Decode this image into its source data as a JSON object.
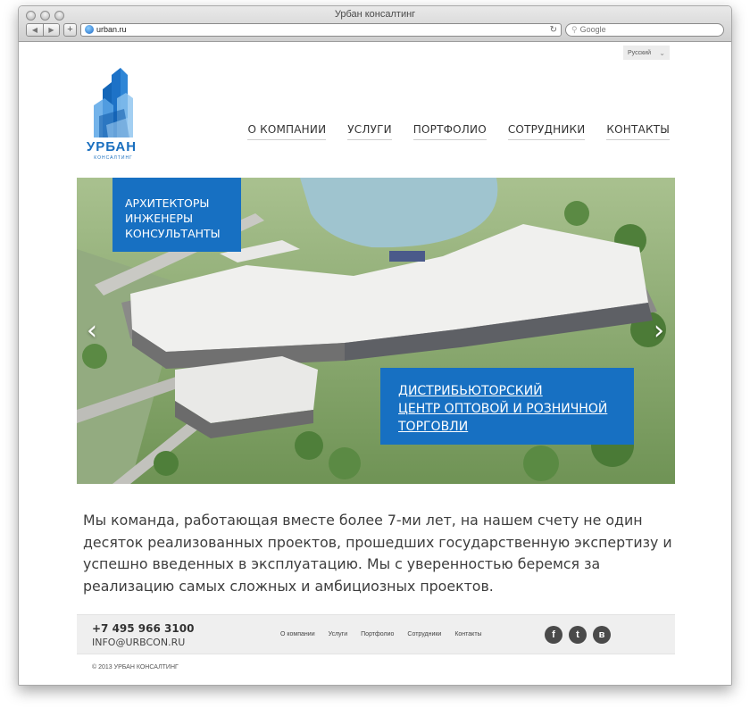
{
  "browser": {
    "window_title": "Урбан консалтинг",
    "url": "urban.ru",
    "search_placeholder": "Google",
    "back_icon": "back-arrow-icon",
    "forward_icon": "forward-arrow-icon",
    "add_icon": "plus-icon",
    "reload_icon": "reload-icon",
    "search_icon": "search-icon"
  },
  "language": {
    "selected": "Русский"
  },
  "logo": {
    "word": "УРБАН",
    "sub": "КОНСАЛТИНГ",
    "color": "#1a6fbf"
  },
  "nav": [
    {
      "label": "О КОМПАНИИ"
    },
    {
      "label": "УСЛУГИ"
    },
    {
      "label": "ПОРТФОЛИО"
    },
    {
      "label": "СОТРУДНИКИ"
    },
    {
      "label": "КОНТАКТЫ"
    }
  ],
  "hero": {
    "tagline": [
      "АРХИТЕКТОРЫ",
      "ИНЖЕНЕРЫ",
      "КОНСУЛЬТАНТЫ"
    ],
    "project_lines": [
      "ДИСТРИБЬЮТОРСКИЙ ",
      "ЦЕНТР ОПТОВОЙ И РОЗНИЧНОЙ ",
      "ТОРГОВЛИ"
    ],
    "prev": "‹",
    "next": "›",
    "accent": "#1770c2"
  },
  "intro": "Мы команда, работающая вместе более 7-ми лет, на нашем счету не один десяток реализованных проектов, прошедших государственную экспертизу и успешно введенных в эксплуатацию. Мы с уверенностью беремся за реализацию самых сложных и амбициозных проектов.",
  "footer": {
    "phone": "+7 495 966 3100",
    "email": "INFO@URBCON.RU",
    "nav": [
      {
        "label": "О компании"
      },
      {
        "label": "Услуги"
      },
      {
        "label": "Портфолио"
      },
      {
        "label": "Сотрудники"
      },
      {
        "label": "Контакты"
      }
    ],
    "social": [
      {
        "glyph": "f",
        "icon": "facebook-icon"
      },
      {
        "glyph": "t",
        "icon": "twitter-icon"
      },
      {
        "glyph": "в",
        "icon": "vkontakte-icon"
      }
    ],
    "copyright": "© 2013 УРБАН КОНСАЛТИНГ"
  }
}
